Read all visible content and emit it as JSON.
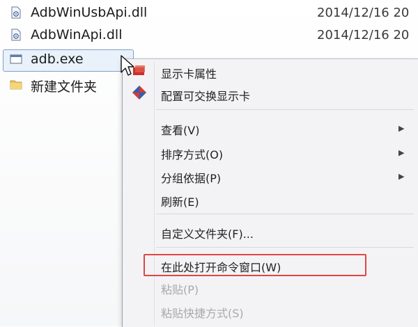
{
  "files": [
    {
      "name": "AdbWinUsbApi.dll",
      "date": "2014/12/16 20",
      "icon": "dll-file-icon"
    },
    {
      "name": "AdbWinApi.dll",
      "date": "2014/12/16 20",
      "icon": "dll-file-icon"
    },
    {
      "name": "adb.exe",
      "date": "",
      "icon": "exe-file-icon"
    },
    {
      "name": "新建文件夹",
      "date": "",
      "icon": "folder-icon"
    }
  ],
  "context_menu": {
    "items": [
      {
        "label": "显示卡属性",
        "icon": "display-properties-icon"
      },
      {
        "label": "配置可交换显示卡",
        "icon": "switchable-graphics-icon"
      },
      {
        "label": "查看(V)",
        "submenu": true
      },
      {
        "label": "排序方式(O)",
        "submenu": true
      },
      {
        "label": "分组依据(P)",
        "submenu": true
      },
      {
        "label": "刷新(E)"
      },
      {
        "label": "自定义文件夹(F)..."
      },
      {
        "label": "在此处打开命令窗口(W)",
        "highlighted": true
      },
      {
        "label": "粘贴(P)",
        "disabled": true
      },
      {
        "label": "粘贴快捷方式(S)",
        "disabled": true
      }
    ]
  },
  "colors": {
    "highlight_border": "#e04545",
    "selection_border": "#7f9ec9"
  }
}
